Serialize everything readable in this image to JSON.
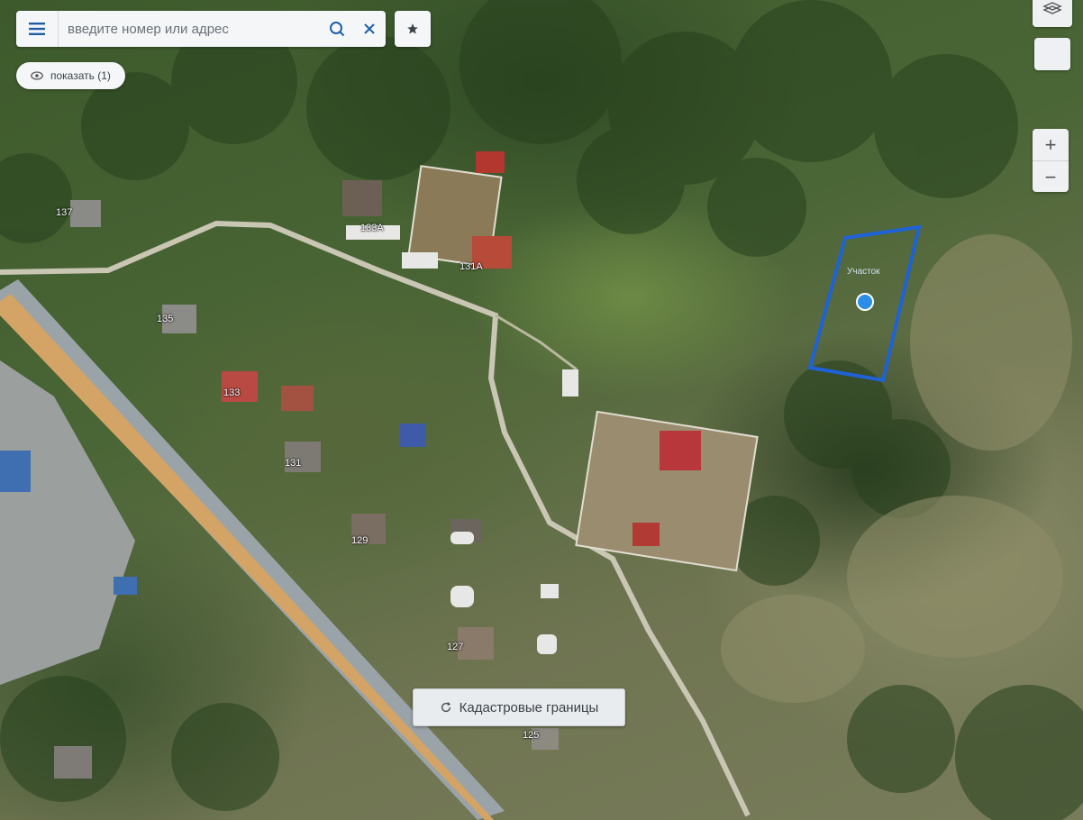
{
  "search": {
    "placeholder": "введите номер или адрес",
    "menu_icon": "hamburger-menu-icon",
    "search_icon": "magnifier-icon",
    "clear_icon": "close-icon"
  },
  "favorites": {
    "icon": "star-icon"
  },
  "show_button": {
    "label": "показать (1)",
    "icon": "eye-icon"
  },
  "map_controls": {
    "layers_icon": "layers-icon",
    "zoom_in": "+",
    "zoom_out": "−"
  },
  "cadastre_button": {
    "label": "Кадастровые границы",
    "icon": "refresh-icon"
  },
  "house_numbers": [
    "137",
    "133А",
    "131А",
    "135",
    "133",
    "131",
    "129",
    "127",
    "125"
  ],
  "parcel": {
    "label": "Участок",
    "outline_color": "#1f62d6",
    "marker_color": "#2a8de6"
  },
  "colors": {
    "road_main": "#d3a465",
    "road_edge": "#9aa3a8",
    "dirt_road": "#c9c6b3"
  }
}
